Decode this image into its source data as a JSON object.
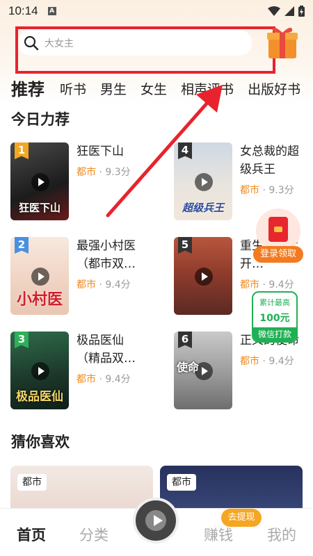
{
  "status_bar": {
    "time": "10:14",
    "a_badge": "A"
  },
  "search": {
    "placeholder": "大女主"
  },
  "tabs": [
    {
      "label": "推荐",
      "active": true
    },
    {
      "label": "听书"
    },
    {
      "label": "男生"
    },
    {
      "label": "女生"
    },
    {
      "label": "相声评书"
    },
    {
      "label": "出版好书"
    }
  ],
  "today_section": {
    "title": "今日力荐"
  },
  "books": [
    {
      "rank": "1",
      "title": "狂医下山",
      "category": "都市",
      "score": "· 9.3分",
      "cover_text": "狂医下山",
      "rank_color": "#f5a623"
    },
    {
      "rank": "4",
      "title": "女总裁的超级兵王",
      "category": "都市",
      "score": "· 9.3分",
      "cover_text": "超级兵王",
      "rank_color": "#333333"
    },
    {
      "rank": "2",
      "title": "最强小村医（都市双…",
      "category": "都市",
      "score": "· 9.4分",
      "cover_text": "小村医",
      "rank_color": "#4a90e2"
    },
    {
      "rank": "5",
      "title": "重生1980：开…",
      "category": "都市",
      "score": "· 9.4分",
      "cover_text": "",
      "rank_color": "#333333"
    },
    {
      "rank": "3",
      "title": "极品医仙（精品双…",
      "category": "都市",
      "score": "· 9.4分",
      "cover_text": "极品医仙",
      "rank_color": "#2eaf5a"
    },
    {
      "rank": "6",
      "title": "正义的使命",
      "category": "都市",
      "score": "· 9.4分",
      "cover_text": "使命",
      "rank_color": "#333333"
    }
  ],
  "guess_section": {
    "title": "猜你喜欢"
  },
  "guess_cards": [
    {
      "tag": "都市"
    },
    {
      "tag": "都市"
    }
  ],
  "widgets": {
    "login_label": "登录领取",
    "wechat_line1": "累计最高",
    "wechat_line2": "100元",
    "wechat_line3": "微信打款"
  },
  "bottom_nav": {
    "home": "首页",
    "category": "分类",
    "earn": "赚钱",
    "mine": "我的",
    "withdraw_badge": "去提现"
  },
  "colors": {
    "accent_orange": "#f08a1c",
    "highlight_red": "#e8232e",
    "wechat_green": "#20b054"
  }
}
